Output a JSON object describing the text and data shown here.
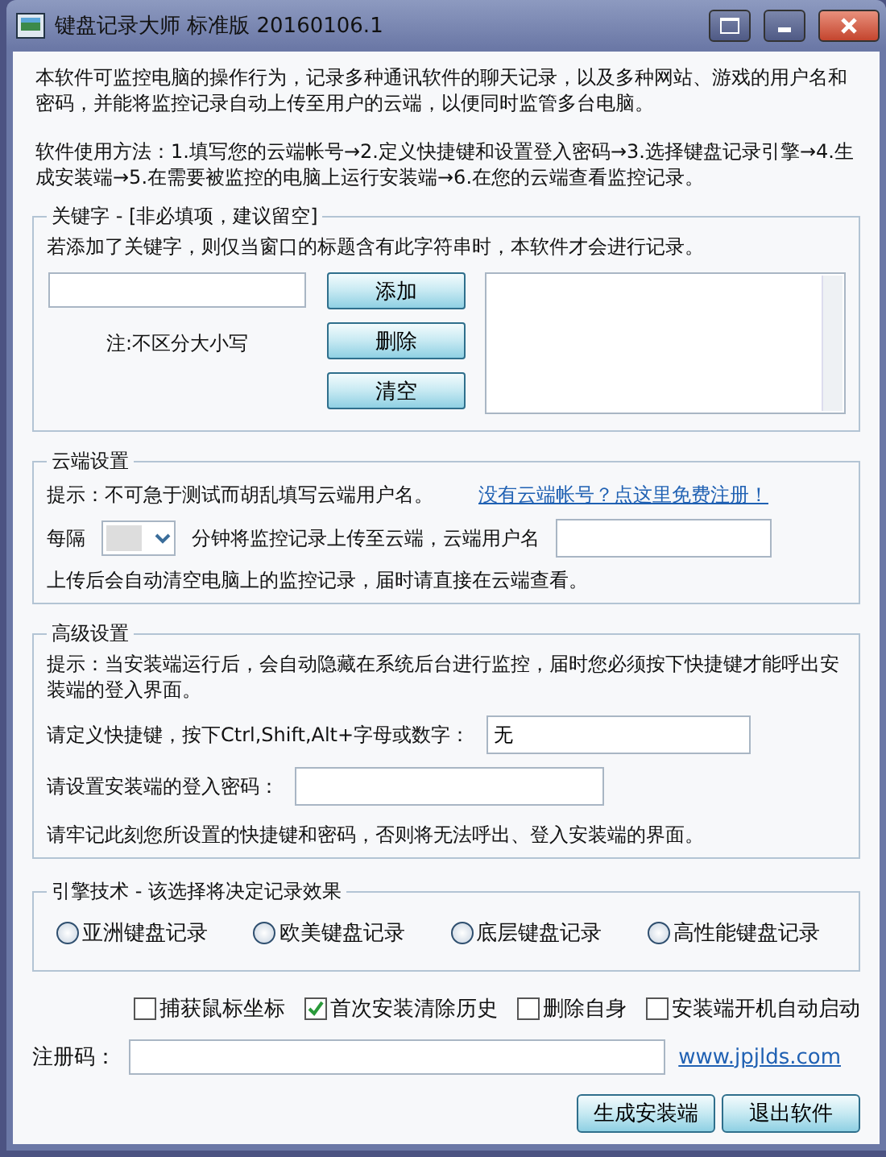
{
  "window": {
    "title": "键盘记录大师 标准版 20160106.1"
  },
  "intro": [
    "本软件可监控电脑的操作行为，记录多种通讯软件的聊天记录，以及多种网站、游戏的用户名和密码，并能将监控记录自动上传至用户的云端，以便同时监管多台电脑。",
    "软件使用方法：1.填写您的云端帐号→2.定义快捷键和设置登入密码→3.选择键盘记录引擎→4.生成安装端→5.在需要被监控的电脑上运行安装端→6.在您的云端查看监控记录。"
  ],
  "keyword_group": {
    "title": "关键字 - [非必填项，建议留空]",
    "hint": "若添加了关键字，则仅当窗口的标题含有此字符串时，本软件才会进行记录。",
    "note": "注:不区分大小写",
    "buttons": [
      "添加",
      "删除",
      "清空"
    ]
  },
  "cloud_group": {
    "title": "云端设置",
    "hint": "提示：不可急于测试而胡乱填写云端用户名。",
    "link": "没有云端帐号？点这里免费注册！",
    "interval_label": "每隔",
    "interval_suffix": "分钟将监控记录上传至云端，云端用户名",
    "note": "上传后会自动清空电脑上的监控记录，届时请直接在云端查看。"
  },
  "advanced_group": {
    "title": "高级设置",
    "hint": "提示：当安装端运行后，会自动隐藏在系统后台进行监控，届时您必须按下快捷键才能呼出安装端的登入界面。",
    "hotkey_label": "请定义快捷键，按下Ctrl,Shift,Alt+字母或数字：",
    "hotkey_value": "无",
    "password_label": "请设置安装端的登入密码：",
    "note": "请牢记此刻您所设置的快捷键和密码，否则将无法呼出、登入安装端的界面。"
  },
  "engine_group": {
    "title": "引擎技术 - 该选择将决定记录效果",
    "options": [
      {
        "label": "亚洲键盘记录",
        "selected": false
      },
      {
        "label": "欧美键盘记录",
        "selected": false
      },
      {
        "label": "底层键盘记录",
        "selected": false
      },
      {
        "label": "高性能键盘记录",
        "selected": false
      }
    ]
  },
  "checkboxes": [
    {
      "label": "捕获鼠标坐标",
      "checked": false
    },
    {
      "label": "首次安装清除历史",
      "checked": true
    },
    {
      "label": "删除自身",
      "checked": false
    },
    {
      "label": "安装端开机自动启动",
      "checked": false
    }
  ],
  "registration": {
    "label": "注册码：",
    "link": "www.jpjlds.com"
  },
  "buttons": [
    "生成安装端",
    "退出软件"
  ]
}
